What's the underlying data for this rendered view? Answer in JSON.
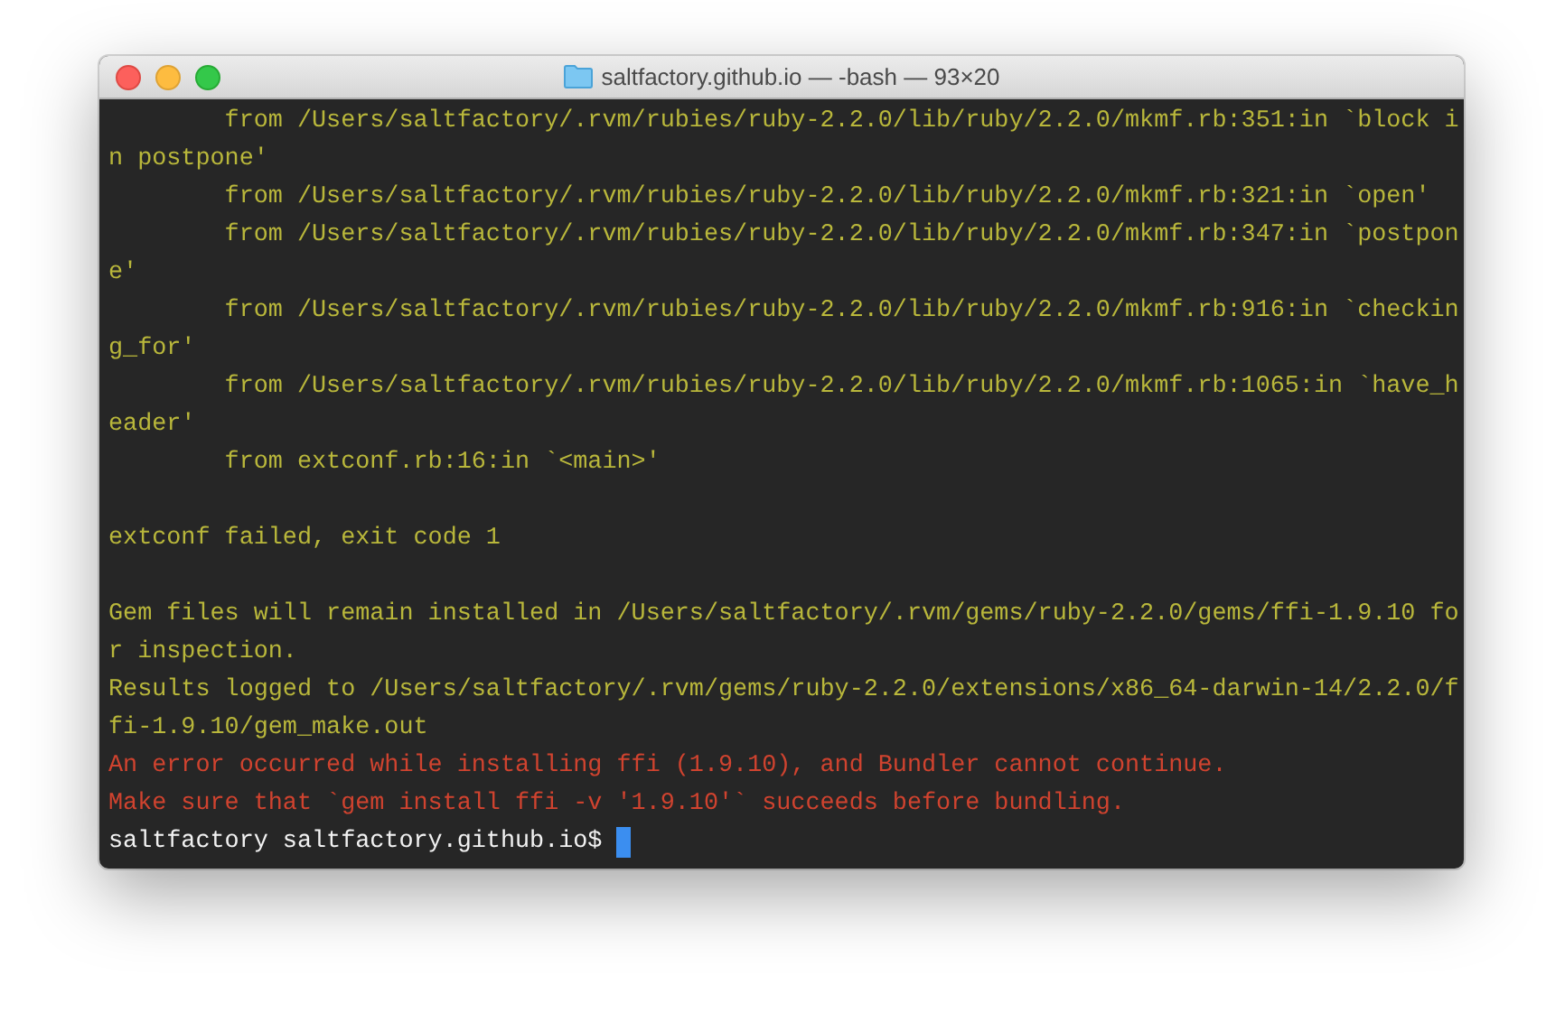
{
  "window": {
    "title": "saltfactory.github.io — -bash — 93×20"
  },
  "terminal": {
    "lines": [
      {
        "kind": "output",
        "text": "        from /Users/saltfactory/.rvm/rubies/ruby-2.2.0/lib/ruby/2.2.0/mkmf.rb:351:in `block i"
      },
      {
        "kind": "output",
        "text": "n postpone'"
      },
      {
        "kind": "output",
        "text": "        from /Users/saltfactory/.rvm/rubies/ruby-2.2.0/lib/ruby/2.2.0/mkmf.rb:321:in `open'"
      },
      {
        "kind": "output",
        "text": "        from /Users/saltfactory/.rvm/rubies/ruby-2.2.0/lib/ruby/2.2.0/mkmf.rb:347:in `postpon"
      },
      {
        "kind": "output",
        "text": "e'"
      },
      {
        "kind": "output",
        "text": "        from /Users/saltfactory/.rvm/rubies/ruby-2.2.0/lib/ruby/2.2.0/mkmf.rb:916:in `checkin"
      },
      {
        "kind": "output",
        "text": "g_for'"
      },
      {
        "kind": "output",
        "text": "        from /Users/saltfactory/.rvm/rubies/ruby-2.2.0/lib/ruby/2.2.0/mkmf.rb:1065:in `have_h"
      },
      {
        "kind": "output",
        "text": "eader'"
      },
      {
        "kind": "output",
        "text": "        from extconf.rb:16:in `<main>'"
      },
      {
        "kind": "blank"
      },
      {
        "kind": "output",
        "text": "extconf failed, exit code 1"
      },
      {
        "kind": "blank"
      },
      {
        "kind": "output",
        "text": "Gem files will remain installed in /Users/saltfactory/.rvm/gems/ruby-2.2.0/gems/ffi-1.9.10 fo"
      },
      {
        "kind": "output",
        "text": "r inspection."
      },
      {
        "kind": "output",
        "text": "Results logged to /Users/saltfactory/.rvm/gems/ruby-2.2.0/extensions/x86_64-darwin-14/2.2.0/f"
      },
      {
        "kind": "output",
        "text": "fi-1.9.10/gem_make.out"
      },
      {
        "kind": "error",
        "text": "An error occurred while installing ffi (1.9.10), and Bundler cannot continue."
      },
      {
        "kind": "error",
        "text": "Make sure that `gem install ffi -v '1.9.10'` succeeds before bundling."
      },
      {
        "kind": "prompt",
        "text": "saltfactory saltfactory.github.io$",
        "cursor": true
      }
    ]
  }
}
